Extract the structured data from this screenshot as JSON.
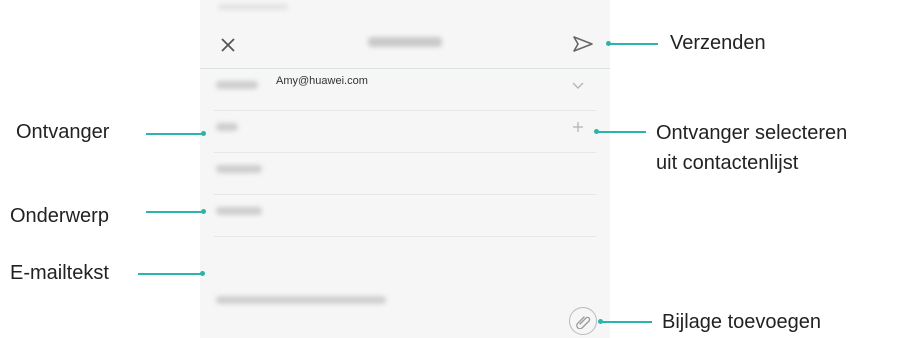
{
  "compose": {
    "from_value": "Amy@huawei.com"
  },
  "callouts": {
    "send": "Verzenden",
    "recipient": "Ontvanger",
    "select_recipient_line1": "Ontvanger selecteren",
    "select_recipient_line2": "uit contactenlijst",
    "subject": "Onderwerp",
    "body": "E-mailtekst",
    "attach": "Bijlage toevoegen"
  },
  "colors": {
    "accent": "#2bb3ac",
    "screen_background": "#f6f6f6"
  },
  "icons": [
    "close-icon",
    "send-icon",
    "chevron-down-icon",
    "plus-icon",
    "paperclip-icon"
  ]
}
